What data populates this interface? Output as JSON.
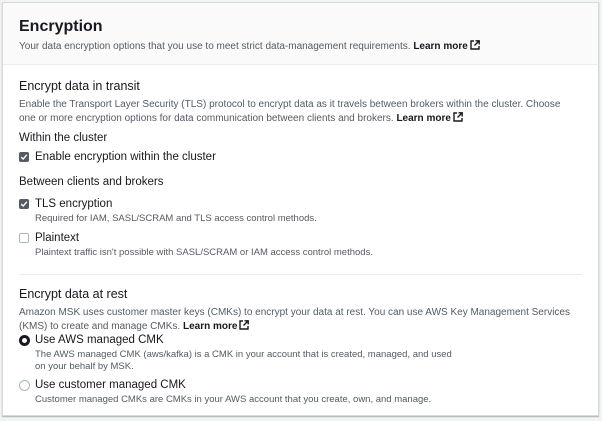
{
  "header": {
    "title": "Encryption",
    "description": "Your data encryption options that you use to meet strict data-management requirements.",
    "learn_more": "Learn more"
  },
  "in_transit": {
    "title": "Encrypt data in transit",
    "description": "Enable the Transport Layer Security (TLS) protocol to encrypt data as it travels between brokers within the cluster. Choose one or more encryption options for data communication between clients and brokers.",
    "learn_more": "Learn more",
    "within_cluster": {
      "title": "Within the cluster",
      "option_label": "Enable encryption within the cluster",
      "checked": true
    },
    "between_clients": {
      "title": "Between clients and brokers",
      "options": [
        {
          "label": "TLS encryption",
          "description": "Required for IAM, SASL/SCRAM and TLS access control methods.",
          "checked": true
        },
        {
          "label": "Plaintext",
          "description": "Plaintext traffic isn't possible with SASL/SCRAM or IAM access control methods.",
          "checked": false
        }
      ]
    }
  },
  "at_rest": {
    "title": "Encrypt data at rest",
    "description": "Amazon MSK uses customer master keys (CMKs) to encrypt your data at rest. You can use AWS Key Management Services (KMS) to create and manage CMKs.",
    "learn_more": "Learn more",
    "options": [
      {
        "label": "Use AWS managed CMK",
        "description_line1": "The AWS managed CMK (aws/kafka) is a CMK in your account that is created, managed, and used",
        "description_line2": "on your behalf by MSK.",
        "selected": true
      },
      {
        "label": "Use customer managed CMK",
        "description_line1": "Customer managed CMKs are CMKs in your AWS account that you create, own, and manage.",
        "selected": false
      }
    ]
  },
  "colors": {
    "panel_bg": "#ffffff",
    "header_bg": "#fafafa",
    "text_primary": "#16191f",
    "text_secondary": "#545b64",
    "border": "#d5dbdb",
    "checkbox_checked": "#545b64"
  },
  "icons": {
    "external_link": "external-link-icon",
    "checkmark": "checkmark-icon"
  }
}
